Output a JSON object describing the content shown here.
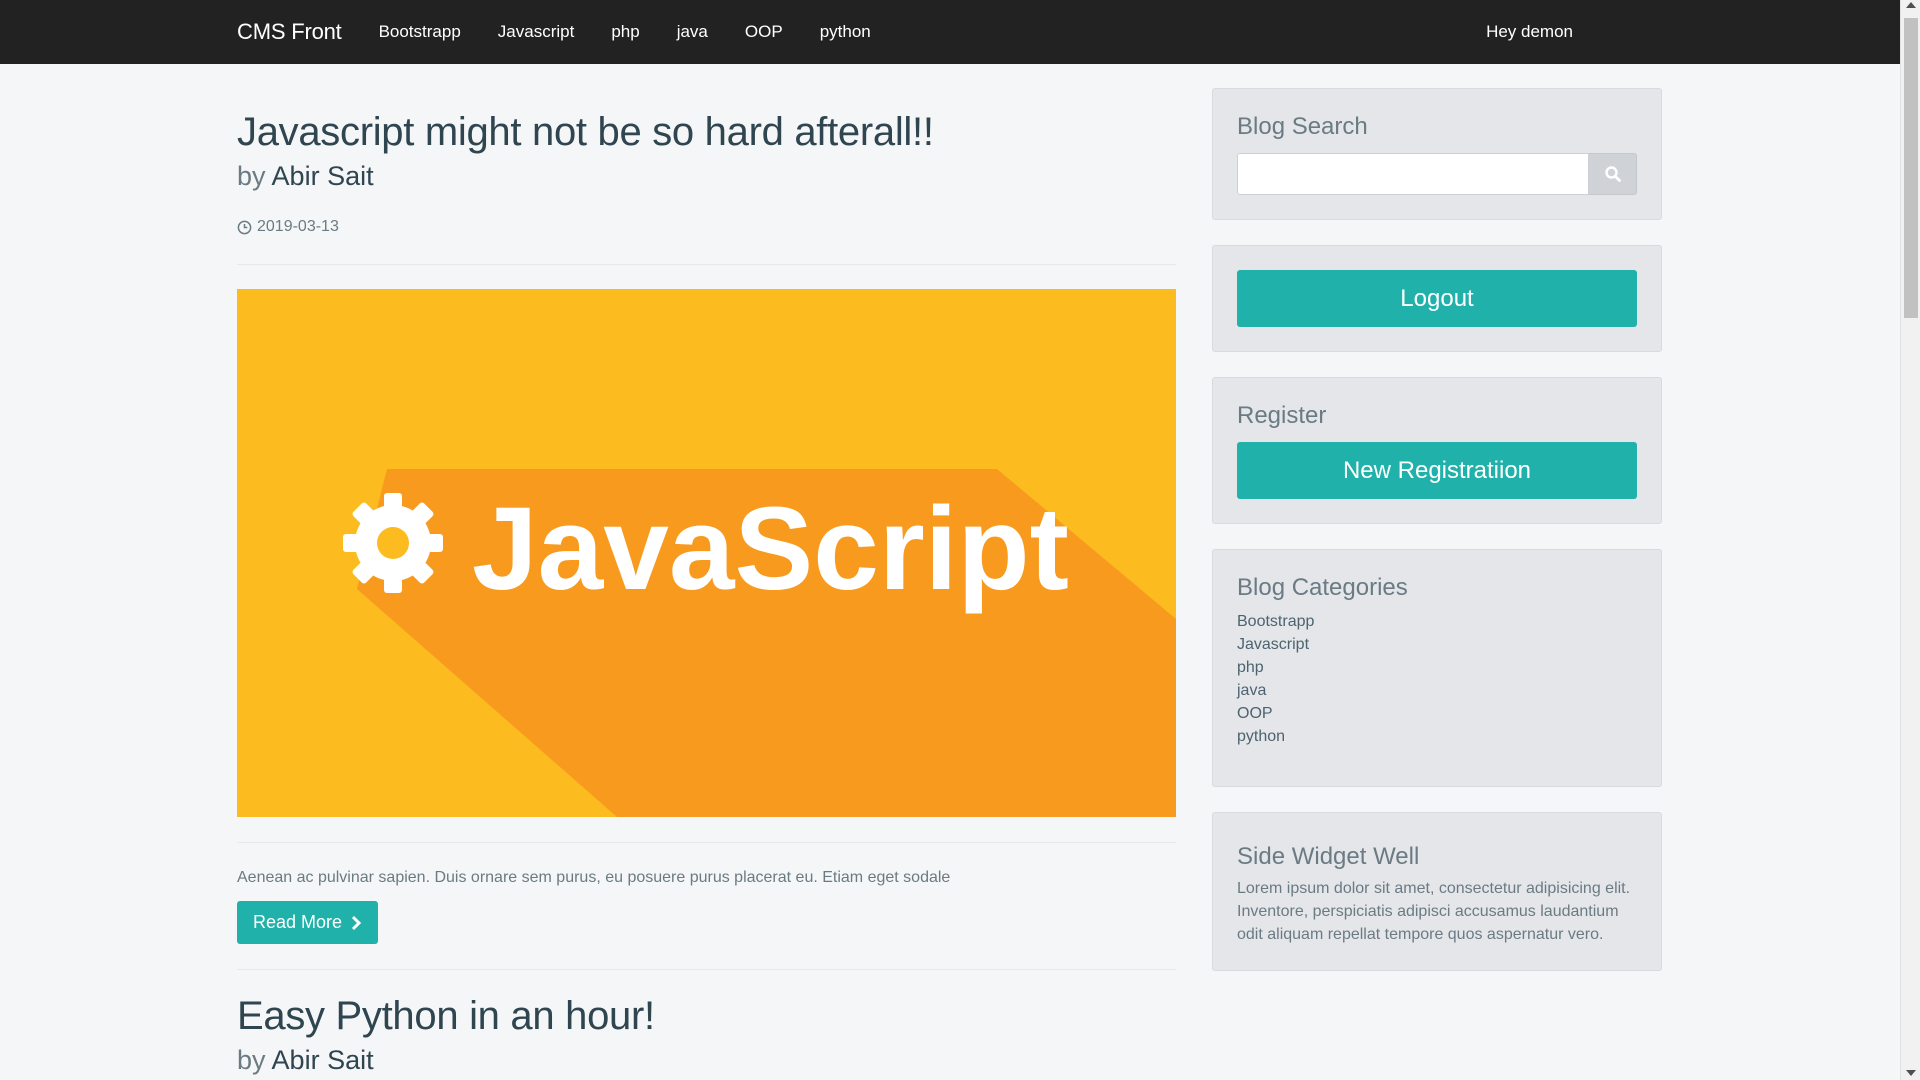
{
  "nav": {
    "brand": "CMS Front",
    "links": [
      "Bootstrapp",
      "Javascript",
      "php",
      "java",
      "OOP",
      "python"
    ],
    "user": "Hey demon"
  },
  "post1": {
    "title": "Javascript might not be so hard afterall!!",
    "by": "by",
    "author": "Abir Sait",
    "date": "2019-03-13",
    "image_text": "JavaScript",
    "excerpt": "Aenean ac pulvinar sapien. Duis ornare sem purus, eu posuere purus placerat eu. Etiam eget sodale",
    "read_more": "Read More"
  },
  "post2": {
    "title": "Easy Python in an hour!",
    "by": "by",
    "author": "Abir Sait"
  },
  "sidebar": {
    "search_title": "Blog Search",
    "search_value": "",
    "logout": "Logout",
    "register_title": "Register",
    "register_button": "New Registratiion",
    "categories_title": "Blog Categories",
    "categories": [
      "Bootstrapp",
      "Javascript",
      "php",
      "java",
      "OOP",
      "python"
    ],
    "widget_title": "Side Widget Well",
    "widget_text": "Lorem ipsum dolor sit amet, consectetur adipisicing elit. Inventore, perspiciatis adipisci accusamus laudantium odit aliquam repellat tempore quos aspernatur vero."
  },
  "colors": {
    "navbar": "#222222",
    "accent": "#20b2aa",
    "image_bg": "#fcbb1f",
    "image_shadow": "#f89a1e"
  }
}
